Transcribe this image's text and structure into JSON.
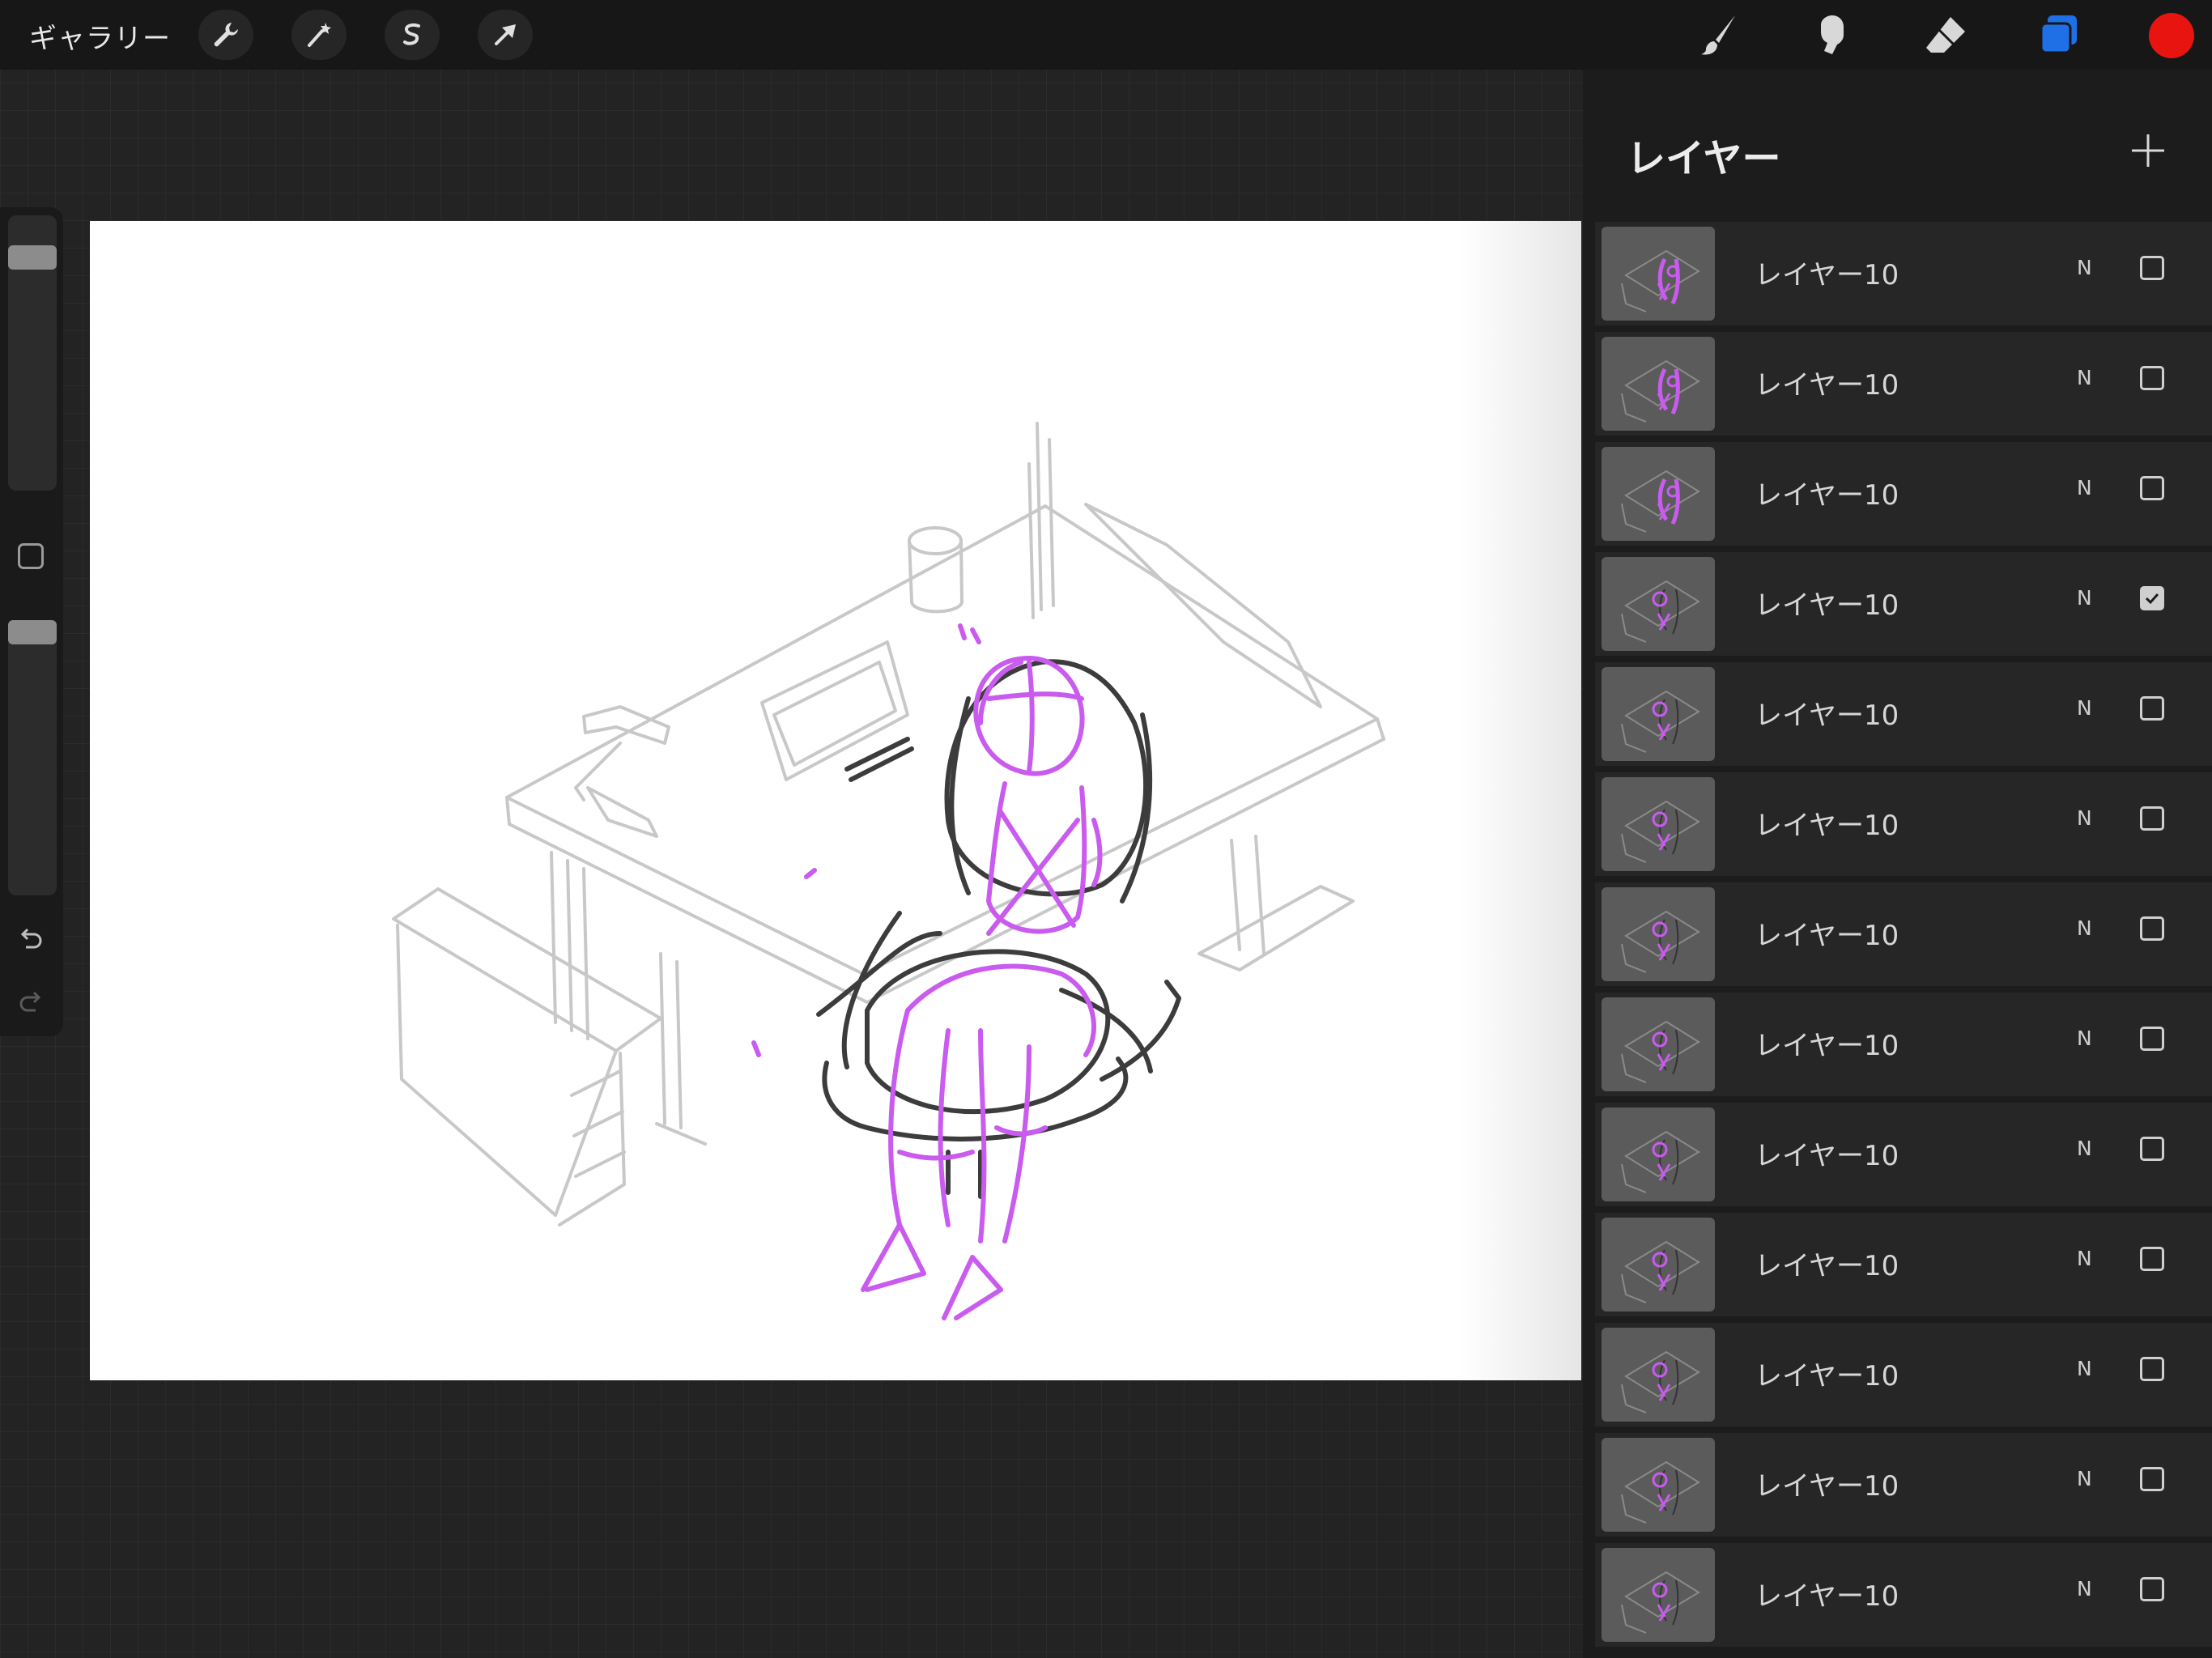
{
  "toolbar": {
    "gallery_label": "ギャラリー",
    "left_tools": [
      "wrench-icon",
      "magic-wand-icon",
      "selection-icon",
      "transform-arrow-icon"
    ],
    "right_tools": [
      "brush-icon",
      "smudge-icon",
      "eraser-icon",
      "layers-icon"
    ],
    "current_color": "#e8140f",
    "layers_active_color": "#1f6fe6"
  },
  "sidebar": {
    "brush_size_level": 0.88,
    "opacity_level": 1.0
  },
  "canvas": {
    "sketch_gray": "#c8c8c8",
    "sketch_dark": "#3c3c3c",
    "sketch_purple": "#c95bef"
  },
  "layers_panel": {
    "title": "レイヤー",
    "add_icon": "plus-icon",
    "layers": [
      {
        "name": "レイヤー10",
        "mode": "N",
        "visible": false
      },
      {
        "name": "レイヤー10",
        "mode": "N",
        "visible": false
      },
      {
        "name": "レイヤー10",
        "mode": "N",
        "visible": false
      },
      {
        "name": "レイヤー10",
        "mode": "N",
        "visible": true
      },
      {
        "name": "レイヤー10",
        "mode": "N",
        "visible": false
      },
      {
        "name": "レイヤー10",
        "mode": "N",
        "visible": false
      },
      {
        "name": "レイヤー10",
        "mode": "N",
        "visible": false
      },
      {
        "name": "レイヤー10",
        "mode": "N",
        "visible": false
      },
      {
        "name": "レイヤー10",
        "mode": "N",
        "visible": false
      },
      {
        "name": "レイヤー10",
        "mode": "N",
        "visible": false
      },
      {
        "name": "レイヤー10",
        "mode": "N",
        "visible": false
      },
      {
        "name": "レイヤー10",
        "mode": "N",
        "visible": false
      },
      {
        "name": "レイヤー10",
        "mode": "N",
        "visible": false
      }
    ]
  }
}
